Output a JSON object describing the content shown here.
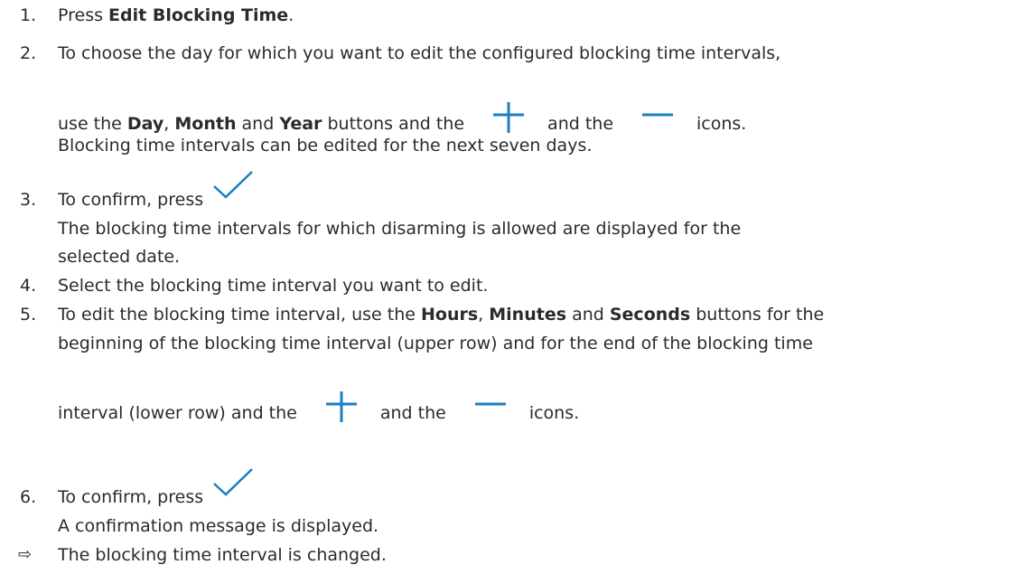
{
  "steps": [
    {
      "number": "1.",
      "press": "Press ",
      "bold": "Edit Blocking Time",
      "end": "."
    },
    {
      "number": "2.",
      "line1": "To choose the day for which you want to edit the configured blocking time intervals,",
      "l2_a": "use the ",
      "l2_day": "Day",
      "l2_comma": ", ",
      "l2_month": "Month",
      "l2_and": " and ",
      "l2_year": "Year",
      "l2_buttons": " buttons and the",
      "l2_andthe": "and the",
      "l2_icons": "icons.",
      "line3": "Blocking time intervals can be edited for the next seven days."
    },
    {
      "number": "3.",
      "line1": "To confirm, press",
      "line2": "The blocking time intervals for which disarming is allowed are displayed for the",
      "line3": "selected date."
    },
    {
      "number": "4.",
      "line1": "Select the blocking time interval you want to edit."
    },
    {
      "number": "5.",
      "l1_a": "To edit the blocking time interval, use the ",
      "l1_hours": "Hours",
      "l1_comma": ", ",
      "l1_minutes": "Minutes",
      "l1_and": " and ",
      "l1_seconds": "Seconds",
      "l1_end": " buttons for the",
      "line2": "beginning of the blocking time interval (upper row) and for the end of the blocking time",
      "l3_a": "interval (lower row) and the",
      "l3_andthe": "and the",
      "l3_icons": "icons."
    },
    {
      "number": "6.",
      "line1": "To confirm, press",
      "line2": "A confirmation message is displayed."
    }
  ],
  "result": {
    "arrow": "⇨",
    "text": "The blocking time interval is changed."
  },
  "icons": {
    "plus": "plus-icon",
    "minus": "minus-icon",
    "check": "checkmark-icon",
    "color": "#1a7fc1"
  }
}
